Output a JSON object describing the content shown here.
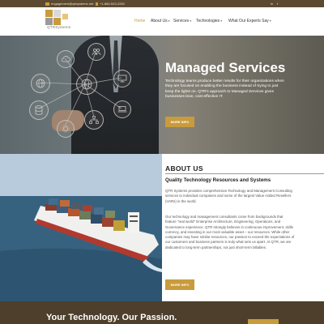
{
  "topbar": {
    "email": "engagement@qtrsystems.net",
    "phone": "+1-866-543-2282",
    "social": [
      "in",
      "f"
    ]
  },
  "logo": {
    "text": "QTRSystems"
  },
  "nav": {
    "items": [
      {
        "label": "Home",
        "active": true
      },
      {
        "label": "About Us",
        "dropdown": true
      },
      {
        "label": "Services",
        "dropdown": true
      },
      {
        "label": "Technologies",
        "dropdown": true
      },
      {
        "label": "What Our Experts Say",
        "dropdown": true
      }
    ]
  },
  "hero": {
    "title": "Managed Services",
    "text": "Technology teams produce better results for their organizations when they are focused on enabling the business instead of trying to just keep the lights on. QTR's approach to Managed Services gives businesses lean, cost-effective IT.",
    "button": "MORE INFO"
  },
  "about": {
    "title": "ABOUT US",
    "subtitle": "Quality Technology Resources and Systems",
    "paragraphs": [
      "QTR Systems provides comprehensive Technology and Management Consulting services to individual companies and some of the largest Value Added Resellers (VARs) in the world.",
      "Our technology and management consultants come from backgrounds that feature \"real world\" Enterprise Architecture, Engineering, Operations, and Governance experience. QTR strongly believes in continuous improvement, skills currency, and investing in our most valuable asset – our resources. While other companies may have similar resources, our passion to exceed the expectations of our customers and business partners is truly what sets us apart. At QTR, we are dedicated to long-term partnerships, not just short-term billables."
    ],
    "button": "MORE INFO"
  },
  "bottom": {
    "title": "Your Technology. Our Passion."
  },
  "colors": {
    "accent": "#c89b3c",
    "topbar": "#5b4a31",
    "bottom_band": "#4d3f2b"
  }
}
